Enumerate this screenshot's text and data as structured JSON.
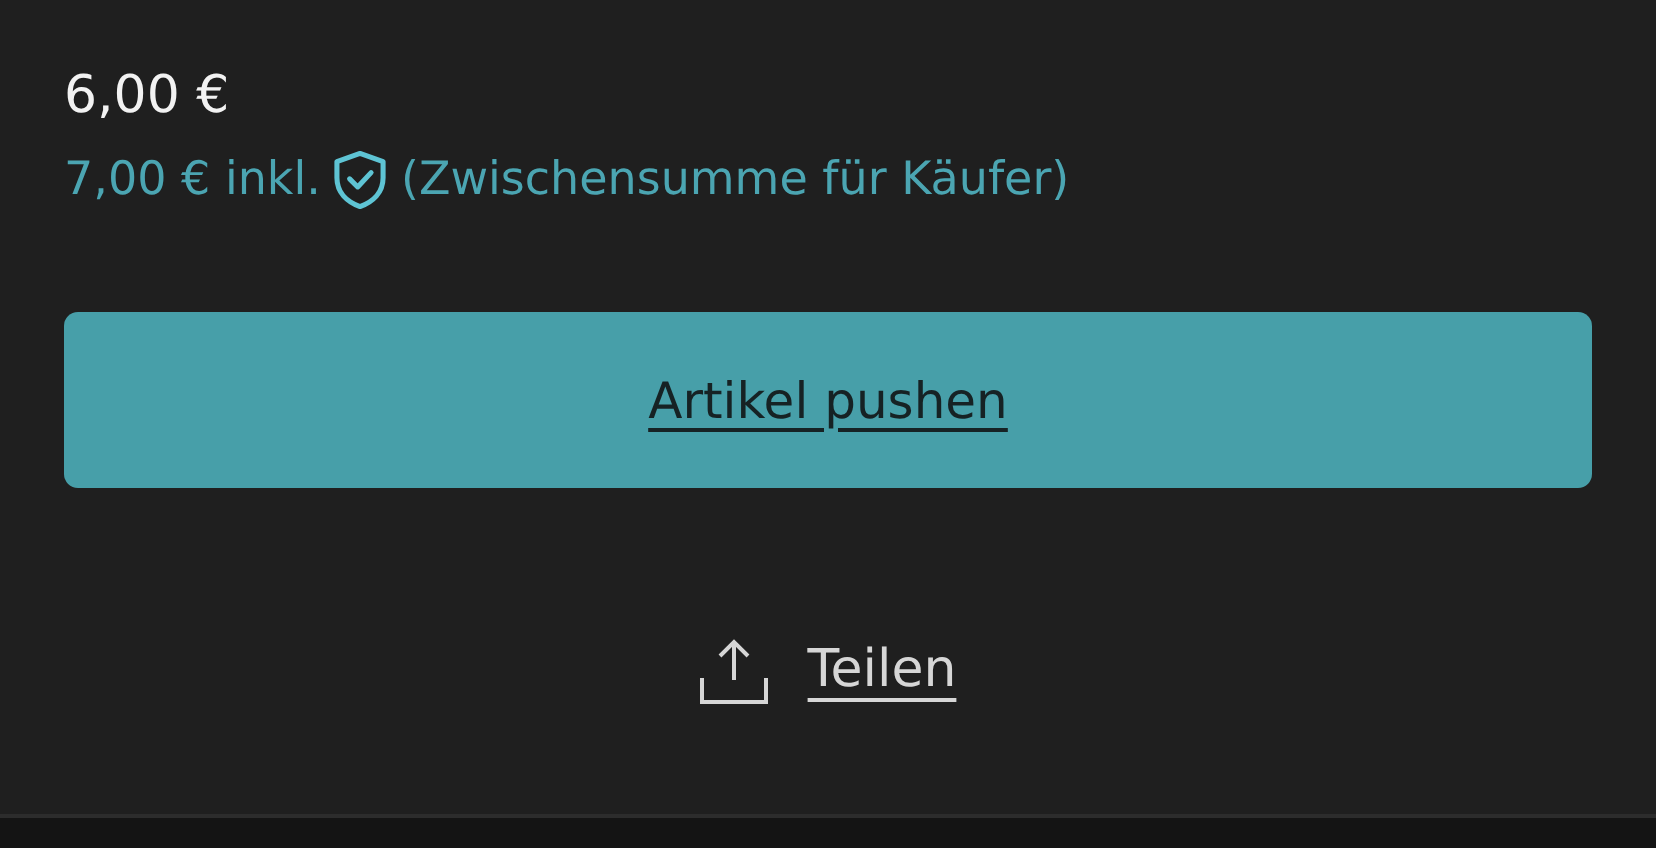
{
  "price": "6,00 €",
  "buyer_price": {
    "amount": "7,00 € inkl.",
    "note": "(Zwischensumme für Käufer)"
  },
  "primary_button": {
    "label": "Artikel pushen"
  },
  "share_link": {
    "label": "Teilen"
  }
}
